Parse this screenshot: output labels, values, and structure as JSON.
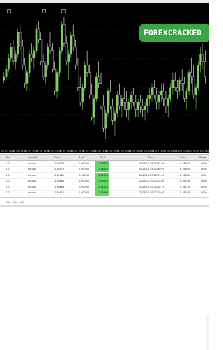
{
  "watermark": {
    "text": "FOREXCRACKED"
  },
  "colors": {
    "bull": "#7fcf5a",
    "bear": "#ffffff",
    "chart_bg": "#000000",
    "grid": "#1a3a1a",
    "profit_bg": "#66d466",
    "badge": "#3aa544"
  },
  "chart_data": {
    "type": "candlestick",
    "series": [
      {
        "values": [
          [
            120,
            124,
            118,
            122
          ],
          [
            122,
            128,
            120,
            126
          ],
          [
            126,
            134,
            124,
            132
          ],
          [
            132,
            140,
            130,
            138
          ],
          [
            138,
            142,
            128,
            130
          ],
          [
            130,
            136,
            126,
            134
          ],
          [
            134,
            148,
            132,
            146
          ],
          [
            146,
            150,
            136,
            138
          ],
          [
            138,
            142,
            126,
            128
          ],
          [
            128,
            132,
            116,
            118
          ],
          [
            118,
            126,
            114,
            124
          ],
          [
            124,
            136,
            122,
            134
          ],
          [
            134,
            140,
            130,
            132
          ],
          [
            132,
            138,
            126,
            136
          ],
          [
            136,
            150,
            134,
            148
          ],
          [
            148,
            152,
            140,
            142
          ],
          [
            142,
            146,
            128,
            130
          ],
          [
            130,
            134,
            120,
            122
          ],
          [
            122,
            130,
            118,
            128
          ],
          [
            128,
            140,
            126,
            138
          ],
          [
            138,
            146,
            134,
            136
          ],
          [
            136,
            140,
            124,
            126
          ],
          [
            126,
            130,
            112,
            114
          ],
          [
            114,
            126,
            110,
            124
          ],
          [
            124,
            138,
            122,
            136
          ],
          [
            136,
            152,
            134,
            150
          ],
          [
            150,
            154,
            138,
            140
          ],
          [
            140,
            144,
            128,
            130
          ],
          [
            130,
            136,
            120,
            134
          ],
          [
            134,
            146,
            132,
            144
          ],
          [
            144,
            150,
            136,
            138
          ],
          [
            138,
            142,
            126,
            128
          ],
          [
            128,
            132,
            114,
            116
          ],
          [
            116,
            122,
            106,
            108
          ],
          [
            108,
            118,
            104,
            116
          ],
          [
            116,
            130,
            114,
            128
          ],
          [
            128,
            136,
            122,
            124
          ],
          [
            124,
            128,
            110,
            112
          ],
          [
            112,
            118,
            98,
            100
          ],
          [
            100,
            112,
            96,
            110
          ],
          [
            110,
            124,
            108,
            122
          ],
          [
            122,
            130,
            116,
            118
          ],
          [
            118,
            124,
            104,
            106
          ],
          [
            106,
            112,
            92,
            94
          ],
          [
            94,
            104,
            88,
            102
          ],
          [
            102,
            116,
            100,
            114
          ],
          [
            114,
            120,
            104,
            106
          ],
          [
            106,
            110,
            96,
            98
          ],
          [
            98,
            104,
            90,
            102
          ],
          [
            102,
            114,
            100,
            112
          ],
          [
            112,
            118,
            104,
            106
          ],
          [
            106,
            112,
            100,
            110
          ],
          [
            110,
            116,
            104,
            108
          ],
          [
            108,
            114,
            100,
            104
          ],
          [
            104,
            110,
            98,
            108
          ],
          [
            108,
            114,
            104,
            112
          ],
          [
            112,
            116,
            106,
            108
          ],
          [
            108,
            112,
            100,
            104
          ],
          [
            104,
            110,
            100,
            108
          ],
          [
            108,
            112,
            102,
            106
          ],
          [
            106,
            110,
            100,
            104
          ],
          [
            104,
            108,
            98,
            106
          ],
          [
            106,
            112,
            102,
            110
          ],
          [
            110,
            116,
            106,
            112
          ],
          [
            112,
            118,
            108,
            116
          ],
          [
            116,
            120,
            110,
            112
          ],
          [
            112,
            116,
            104,
            108
          ],
          [
            108,
            114,
            104,
            112
          ],
          [
            112,
            118,
            108,
            114
          ],
          [
            114,
            118,
            106,
            110
          ],
          [
            110,
            114,
            102,
            106
          ],
          [
            106,
            112,
            100,
            110
          ],
          [
            110,
            118,
            108,
            116
          ],
          [
            116,
            124,
            112,
            120
          ],
          [
            120,
            124,
            114,
            116
          ],
          [
            116,
            120,
            110,
            114
          ],
          [
            114,
            122,
            112,
            120
          ],
          [
            120,
            126,
            114,
            118
          ],
          [
            118,
            122,
            108,
            110
          ],
          [
            110,
            116,
            104,
            114
          ],
          [
            114,
            126,
            112,
            124
          ],
          [
            124,
            132,
            118,
            122
          ],
          [
            122,
            128,
            110,
            112
          ],
          [
            112,
            118,
            104,
            116
          ],
          [
            116,
            130,
            114,
            128
          ],
          [
            128,
            138,
            124,
            134
          ],
          [
            134,
            140,
            126,
            130
          ],
          [
            130,
            136,
            118,
            122
          ]
        ]
      }
    ],
    "x_tick_labels": [
      "28 Oct 2025",
      "29 Oct 14:00",
      "29 Oct 18:00",
      "29 Oct 22:00",
      "30 Oct 02:00",
      "30 Oct 06:00",
      "30 Oct 10:00",
      "30 Oct 14:00",
      "30 Oct 18:00",
      "30 Oct 22:00",
      "31 Oct 02:00",
      "31 Oct 06:00",
      "31 Oct 10:00",
      "31 Oct 14:00",
      "31 Oct 18:00",
      "31 Oct 22:00",
      "1 Nov 02:00",
      "1 Nov 06:00"
    ]
  },
  "table": {
    "headers": [
      "Size",
      "Symbol",
      "Price",
      "S / L",
      "T / P",
      "Time",
      "Price",
      "Swap"
    ],
    "rows": [
      {
        "size": "0.01",
        "symbol": "eurusd",
        "price": "1.16572",
        "sl": "0.00000",
        "tp": "1.16620",
        "time": "2025.10.29 22:32:26",
        "close": "1.16622",
        "swap": "0.00"
      },
      {
        "size": "0.01",
        "symbol": "eurusd",
        "price": "1.16575",
        "sl": "0.00000",
        "tp": "1.16625",
        "time": "2025.10.29 22:40:07",
        "close": "1.16625",
        "swap": "0.00"
      },
      {
        "size": "0.01",
        "symbol": "eurusd",
        "price": "1.16581",
        "sl": "0.00000",
        "tp": "1.16631",
        "time": "2025.10.29 23:11:45",
        "close": "1.16631",
        "swap": "0.00"
      },
      {
        "size": "0.01",
        "symbol": "eurusd",
        "price": "1.16468",
        "sl": "0.00000",
        "tp": "1.16518",
        "time": "2025.10.30 00:15:09",
        "close": "1.16518",
        "swap": "0.00"
      },
      {
        "size": "0.01",
        "symbol": "eurusd",
        "price": "1.16464",
        "sl": "0.00000",
        "tp": "1.16514",
        "time": "2025.10.30 00:20:15",
        "close": "1.16514",
        "swap": "0.00"
      },
      {
        "size": "0.01",
        "symbol": "eurusd",
        "price": "1.16410",
        "sl": "0.00000",
        "tp": "1.16460",
        "time": "2025.10.30 02:25:03",
        "close": "1.16460",
        "swap": "0.00"
      }
    ]
  }
}
